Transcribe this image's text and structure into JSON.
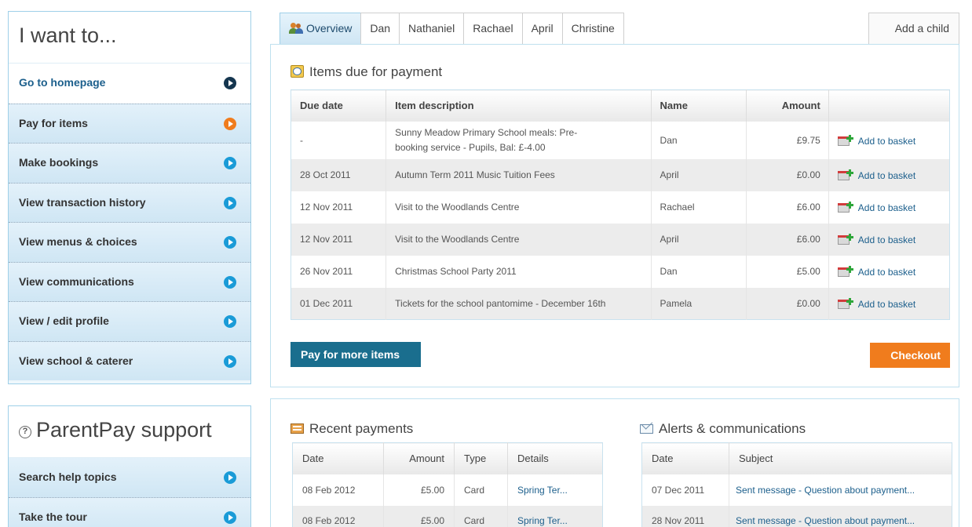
{
  "sidebar": {
    "title": "I want to...",
    "items": [
      {
        "label": "Go to homepage"
      },
      {
        "label": "Pay for items"
      },
      {
        "label": "Make bookings"
      },
      {
        "label": "View transaction history"
      },
      {
        "label": "View menus & choices"
      },
      {
        "label": "View communications"
      },
      {
        "label": "View / edit profile"
      },
      {
        "label": "View school & caterer"
      }
    ]
  },
  "support": {
    "title": "ParentPay support",
    "items": [
      {
        "label": "Search help topics"
      },
      {
        "label": "Take the tour"
      }
    ]
  },
  "tabs": [
    {
      "label": "Overview"
    },
    {
      "label": "Dan"
    },
    {
      "label": "Nathaniel"
    },
    {
      "label": "Rachael"
    },
    {
      "label": "April"
    },
    {
      "label": "Christine"
    }
  ],
  "add_child_label": "Add a child",
  "items_due": {
    "heading": "Items due for payment",
    "columns": [
      "Due date",
      "Item description",
      "Name",
      "Amount"
    ],
    "rows": [
      {
        "date": "-",
        "desc1": "Sunny Meadow Primary School meals: Pre-",
        "desc2": "booking service - Pupils, Bal: £-4.00",
        "name": "Dan",
        "amount": "£9.75",
        "action": "Add to basket"
      },
      {
        "date": "28 Oct 2011",
        "desc1": "Autumn Term 2011 Music Tuition Fees",
        "desc2": "",
        "name": "April",
        "amount": "£0.00",
        "action": "Add to basket"
      },
      {
        "date": "12 Nov 2011",
        "desc1": "Visit to the Woodlands Centre",
        "desc2": "",
        "name": "Rachael",
        "amount": "£6.00",
        "action": "Add to basket"
      },
      {
        "date": "12 Nov 2011",
        "desc1": "Visit to the Woodlands Centre",
        "desc2": "",
        "name": "April",
        "amount": "£6.00",
        "action": "Add to basket"
      },
      {
        "date": "26 Nov 2011",
        "desc1": "Christmas School Party 2011",
        "desc2": "",
        "name": "Dan",
        "amount": "£5.00",
        "action": "Add to basket"
      },
      {
        "date": "01 Dec 2011",
        "desc1": "Tickets for the school pantomime - December 16th",
        "desc2": "",
        "name": "Pamela",
        "amount": "£0.00",
        "action": "Add to basket"
      }
    ],
    "pay_more_label": "Pay for more items",
    "checkout_label": "Checkout"
  },
  "recent_payments": {
    "heading": "Recent payments",
    "columns": [
      "Date",
      "Amount",
      "Type",
      "Details"
    ],
    "rows": [
      {
        "date": "08 Feb 2012",
        "amount": "£5.00",
        "type": "Card",
        "details": "Spring Ter..."
      },
      {
        "date": "08 Feb 2012",
        "amount": "£5.00",
        "type": "Card",
        "details": "Spring Ter..."
      }
    ]
  },
  "alerts": {
    "heading": "Alerts & communications",
    "columns": [
      "Date",
      "Subject"
    ],
    "rows": [
      {
        "date": "07 Dec 2011",
        "subject": "Sent message - Question about payment..."
      },
      {
        "date": "28 Nov 2011",
        "subject": "Sent message - Question about payment..."
      }
    ]
  },
  "colors": {
    "accent": "#1a9bd7",
    "orange": "#f07c1d",
    "pay_button": "#1a6e8e"
  }
}
